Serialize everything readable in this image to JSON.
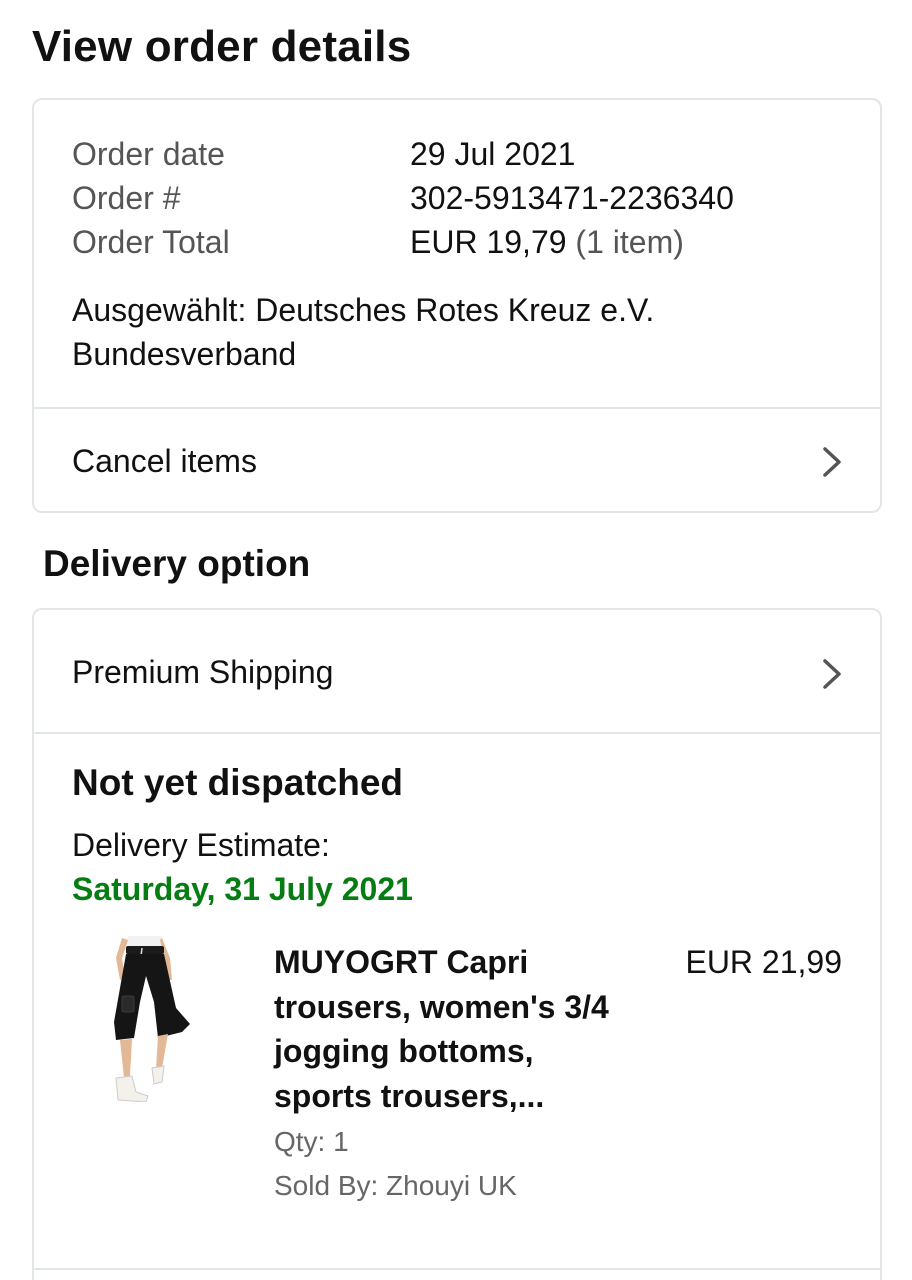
{
  "page": {
    "title": "View order details"
  },
  "order": {
    "date_label": "Order date",
    "date_value": "29 Jul 2021",
    "number_label": "Order #",
    "number_value": "302-5913471-2236340",
    "total_label": "Order Total",
    "total_value": "EUR 19,79",
    "total_items": "(1 item)",
    "charity_line1": "Ausgewählt: Deutsches Rotes Kreuz e.V.",
    "charity_line2": "Bundesverband",
    "cancel_label": "Cancel items"
  },
  "delivery": {
    "section_title": "Delivery option",
    "shipping_label": "Premium Shipping",
    "status": "Not yet dispatched",
    "estimate_label": "Delivery Estimate:",
    "estimate_date": "Saturday, 31 July 2021"
  },
  "item": {
    "title_line1": "MUYOGRT Capri",
    "title_line2": "trousers, women's 3/4",
    "title_line3": "jogging bottoms,",
    "title_line4": "sports trousers,...",
    "price": "EUR 21,99",
    "qty": "Qty: 1",
    "sold_by": "Sold By: Zhouyi UK"
  },
  "colors": {
    "accent_green": "#067d12",
    "border": "#e3e6e6",
    "muted_text": "#555555"
  },
  "icons": [
    "chevron-right-icon",
    "product-thumbnail"
  ]
}
